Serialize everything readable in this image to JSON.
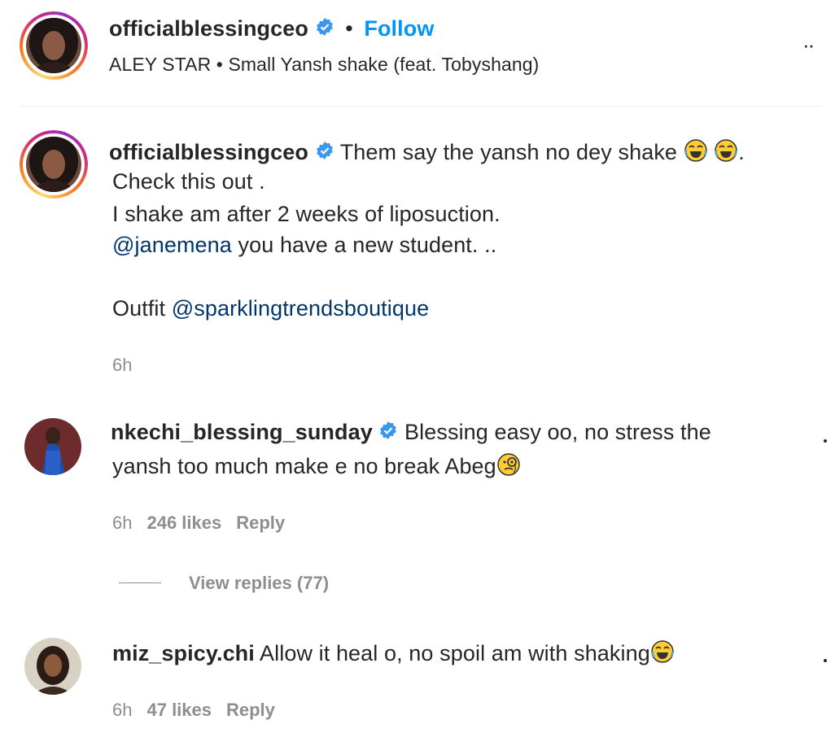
{
  "header": {
    "username": "officialblessingceo",
    "follow_label": "Follow",
    "separator": "•",
    "audio": "ALEY STAR • Small Yansh shake (feat. Tobyshang)",
    "more_label": "··"
  },
  "caption": {
    "username": "officialblessingceo",
    "line1": "Them say the yansh no dey shake",
    "line1_end": ".",
    "line2": "Check this out .",
    "line3": "I shake am after 2 weeks of liposuction.",
    "mention1": "@janemena",
    "line4_rest": " you have a new student. ..",
    "outfit_label": "Outfit ",
    "mention2": "@sparklingtrendsboutique",
    "time": "6h"
  },
  "comments": [
    {
      "username": "nkechi_blessing_sunday",
      "text_line1": "Blessing easy oo, no stress the",
      "text_line2": "yansh too much make e no break Abeg",
      "time": "6h",
      "likes": "246 likes",
      "reply_label": "Reply",
      "view_replies": "View replies (77)"
    },
    {
      "username": "miz_spicy.chi",
      "text_line1": "Allow it heal o, no spoil am with shaking",
      "time": "6h",
      "likes": "47 likes",
      "reply_label": "Reply"
    }
  ],
  "icons": {
    "verified": "verified-badge-icon",
    "laugh": "tears-of-joy-emoji",
    "monocle": "face-with-monocle-emoji"
  },
  "colors": {
    "link": "#0095f6",
    "mention": "#00376b",
    "verified": "#3897f0",
    "muted": "#8e8e8e"
  }
}
